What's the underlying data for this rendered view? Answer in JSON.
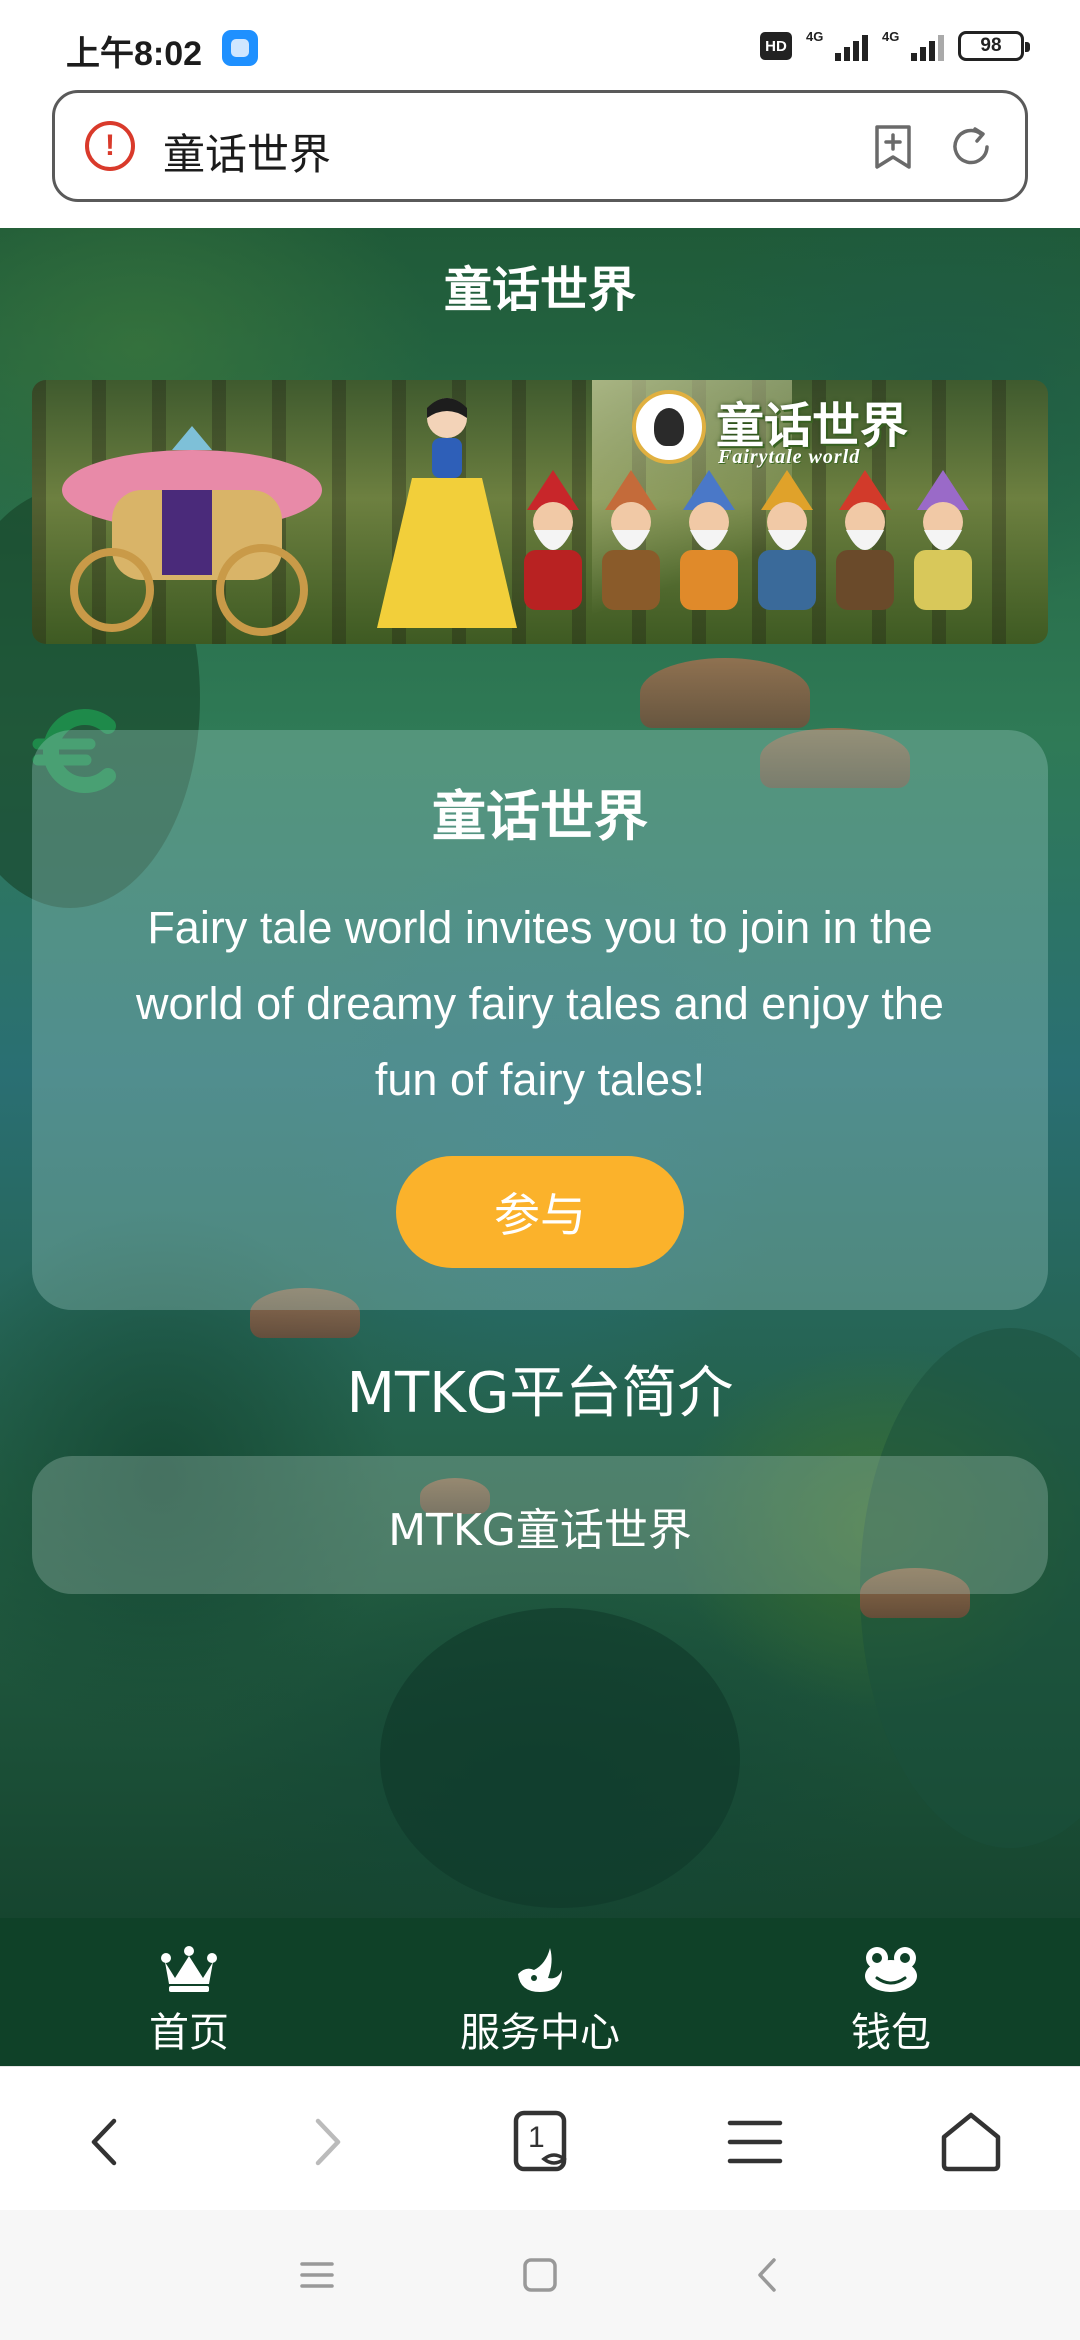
{
  "status_bar": {
    "time": "上午8:02",
    "hd_badge": "HD",
    "signal_1_label": "4G",
    "signal_2_label": "4G",
    "battery": "98"
  },
  "address_bar": {
    "title": "童话世界",
    "security_icon": "warning-circle-icon",
    "bookmark_icon": "add-bookmark-icon",
    "refresh_icon": "refresh-icon"
  },
  "page": {
    "title": "童话世界",
    "banner": {
      "logo_cn": "童话世界",
      "logo_en": "Fairytale world"
    },
    "invite_card": {
      "title": "童话世界",
      "text": "Fairy tale world invites you to join in the world of dreamy fairy tales and enjoy the fun of fairy tales!",
      "button_label": "参与",
      "button_color": "#fbb22b"
    },
    "intro": {
      "heading": "MTKG平台简介",
      "card_text": "MTKG童话世界"
    },
    "floating_icon": "euro-icon",
    "floating_icon_color": "#1e8a4a"
  },
  "tab_bar": {
    "background": "#0f4128",
    "items": [
      {
        "label": "首页",
        "icon": "crown-icon"
      },
      {
        "label": "服务中心",
        "icon": "bird-icon"
      },
      {
        "label": "钱包",
        "icon": "frog-icon"
      }
    ]
  },
  "browser_toolbar": {
    "tab_count": "1",
    "buttons": [
      "back-icon",
      "forward-icon",
      "tabs-icon",
      "menu-icon",
      "home-icon"
    ]
  },
  "system_nav": {
    "buttons": [
      "recents-icon",
      "home-square-icon",
      "back-triangle-icon"
    ]
  }
}
